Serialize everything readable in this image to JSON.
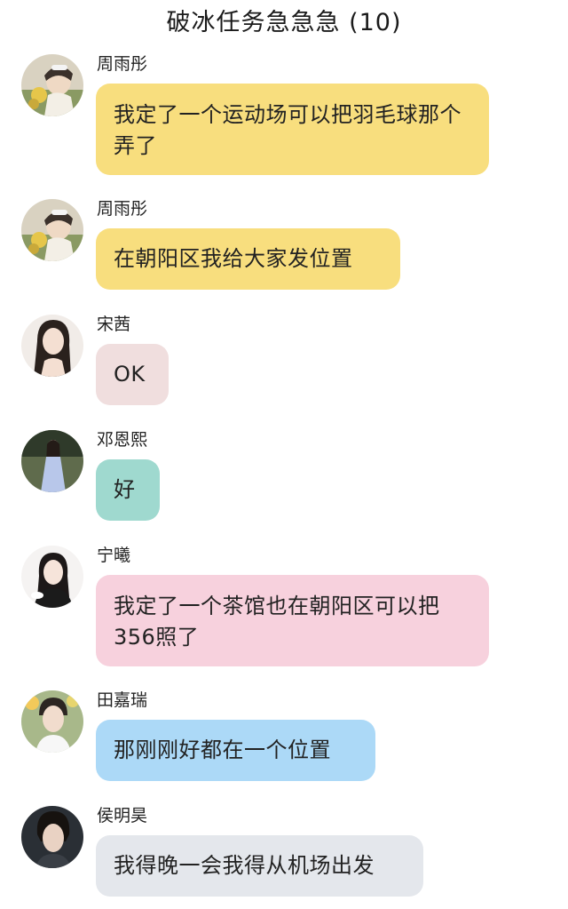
{
  "header": {
    "title": "破冰任务急急急 (10)"
  },
  "messages": [
    {
      "sender": "周雨彤",
      "text": "我定了一个运动场可以把羽毛球那个弄了",
      "bubble_color": "#F8DE7E"
    },
    {
      "sender": "周雨彤",
      "text": "在朝阳区我给大家发位置",
      "bubble_color": "#F8DE7E"
    },
    {
      "sender": "宋茜",
      "text": "OK",
      "bubble_color": "#F0DEDE"
    },
    {
      "sender": "邓恩熙",
      "text": "好",
      "bubble_color": "#9FD9CF"
    },
    {
      "sender": "宁曦",
      "text": "我定了一个茶馆也在朝阳区可以把356照了",
      "bubble_color": "#F7D1DD"
    },
    {
      "sender": "田嘉瑞",
      "text": "那刚刚好都在一个位置",
      "bubble_color": "#ACD9F7"
    },
    {
      "sender": "侯明昊",
      "text": "我得晚一会我得从机场出发",
      "bubble_color": "#E4E7EC"
    }
  ]
}
